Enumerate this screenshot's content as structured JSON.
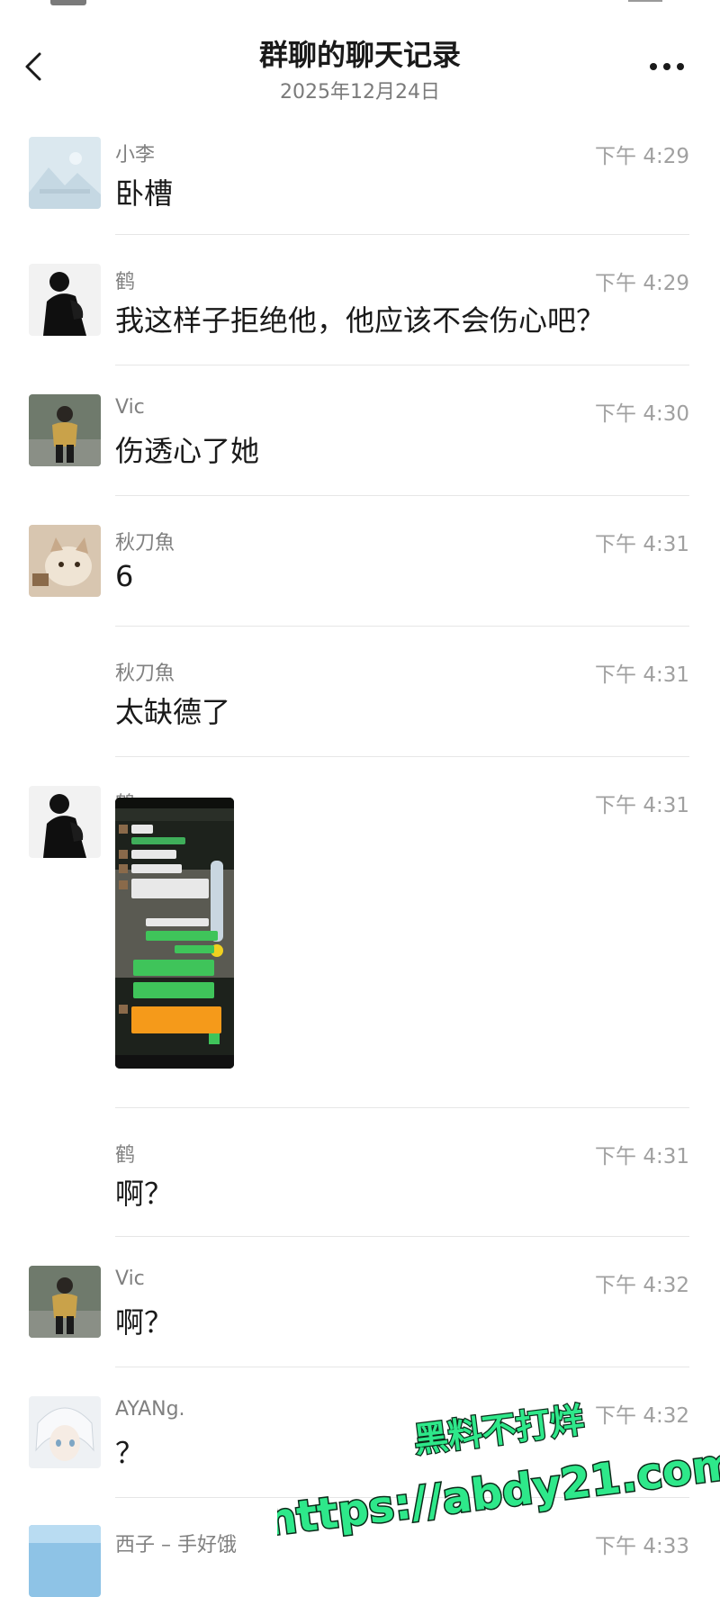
{
  "header": {
    "title": "群聊的聊天记录",
    "date": "2025年12月24日"
  },
  "messages": [
    {
      "sender": "小李",
      "time": "下午 4:29",
      "text": "卧槽",
      "avatar_icon": "landscape-placeholder-avatar"
    },
    {
      "sender": "鹤",
      "time": "下午 4:29",
      "text": "我这样子拒绝他，他应该不会伤心吧？",
      "avatar_icon": "person-dark-avatar"
    },
    {
      "sender": "Vic",
      "time": "下午 4:30",
      "text": "伤透心了她",
      "avatar_icon": "person-photo-avatar"
    },
    {
      "sender": "秋刀魚",
      "time": "下午 4:31",
      "text": "6",
      "avatar_icon": "cat-photo-avatar"
    },
    {
      "sender": "秋刀魚",
      "time": "下午 4:31",
      "text": "太缺德了"
    },
    {
      "sender": "鹤",
      "time": "下午 4:31",
      "image": "chat-screenshot-image",
      "avatar_icon": "person-dark-avatar"
    },
    {
      "sender": "鹤",
      "time": "下午 4:31",
      "text": "啊？"
    },
    {
      "sender": "Vic",
      "time": "下午 4:32",
      "text": "啊？",
      "avatar_icon": "person-photo-avatar"
    },
    {
      "sender": "AYANg.",
      "time": "下午 4:32",
      "text": "？",
      "avatar_icon": "anime-character-avatar"
    },
    {
      "sender": "西子 – 手好饿",
      "time": "下午 4:33",
      "text": "",
      "avatar_icon": "sky-photo-avatar"
    }
  ],
  "watermark": {
    "line1": "黑料不打烊",
    "line2": "https://abdy21.com"
  },
  "colors": {
    "title": "#1a1a1a",
    "secondary_text": "#808080",
    "time_text": "#a0a0a0",
    "divider": "#e6e6e6",
    "watermark_fill": "#2ee88a",
    "watermark_stroke": "#0b2a18"
  }
}
